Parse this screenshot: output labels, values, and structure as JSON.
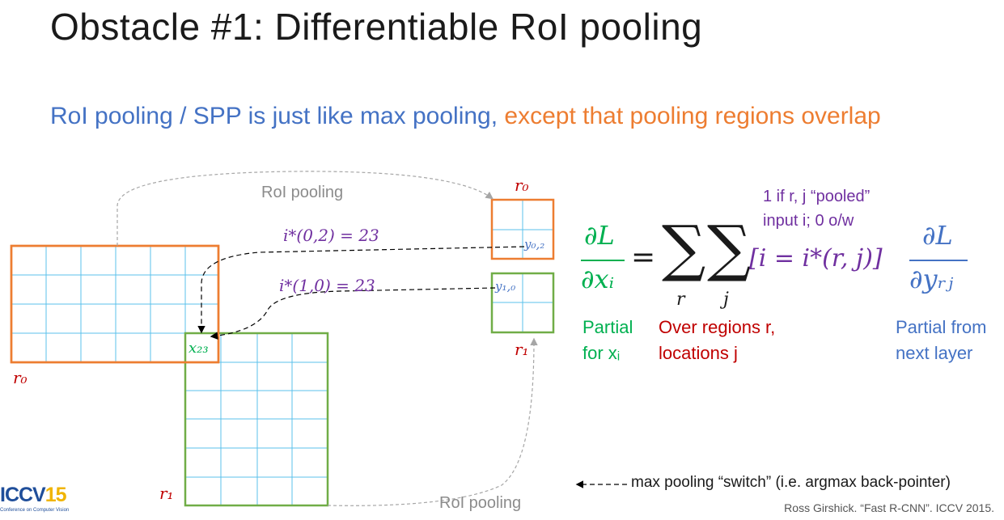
{
  "slide": {
    "title": "Obstacle #1: Differentiable RoI pooling",
    "subtitle_part1": "RoI pooling / SPP is just like max pooling, ",
    "subtitle_part2": "except that pooling regions overlap"
  },
  "diagram": {
    "roi_pooling_top": "RoI pooling",
    "roi_pooling_bottom": "RoI pooling",
    "switch_label_02": "i*(0,2) = 23",
    "switch_label_10": "i*(1,0) = 23",
    "x23_label": "x₂₃",
    "r0_label_left": "r₀",
    "r1_label_left": "r₁",
    "r0_label_out": "r₀",
    "r1_label_out": "r₁",
    "y02_label": "y₀,₂",
    "y10_label": "y₁,₀",
    "colors": {
      "orange": "#ed7d31",
      "green": "#70ad47",
      "cyan": "#5bc0eb",
      "gray": "#a6a6a6"
    }
  },
  "equation": {
    "annotation_line1": "1 if r, j “pooled”",
    "annotation_line2": "input i; 0 o/w",
    "lhs_num": "∂L",
    "lhs_den": "∂xᵢ",
    "equals": "=",
    "sum": "∑",
    "sum_sub_r": "r",
    "sum_sub_j": "j",
    "indicator": "[i = i*(r, j)]",
    "rhs_num": "∂L",
    "rhs_den": "∂yᵣⱼ",
    "caption_partial_1": "Partial",
    "caption_partial_2": "for xᵢ",
    "caption_regions_1": "Over regions r,",
    "caption_regions_2": "locations j",
    "caption_next_1": "Partial from",
    "caption_next_2": "next layer"
  },
  "legend": {
    "text": "max pooling “switch” (i.e. argmax back-pointer)"
  },
  "footer": {
    "logo_main": "ICCV",
    "logo_year": "15",
    "logo_sub": "Conference on Computer Vision",
    "citation": "Ross Girshick. “Fast R-CNN”. ICCV 2015."
  }
}
